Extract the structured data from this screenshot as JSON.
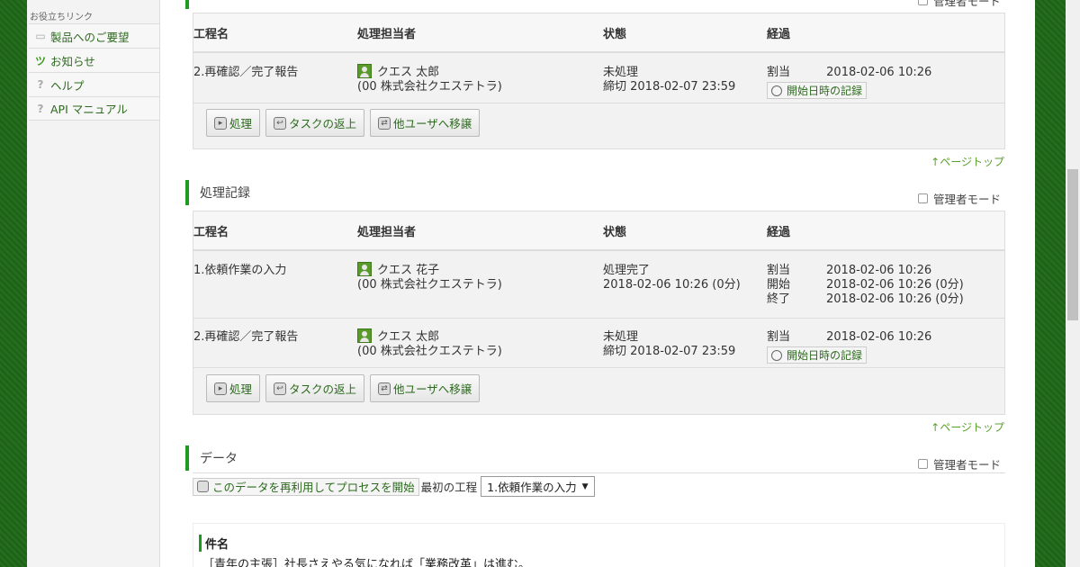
{
  "sidebar": {
    "heading": "お役立ちリンク",
    "items": [
      {
        "label": "製品へのご要望",
        "icon": "speech-icon"
      },
      {
        "label": "お知らせ",
        "icon": "notice-icon"
      },
      {
        "label": "ヘルプ",
        "icon": "question-icon"
      },
      {
        "label": "API マニュアル",
        "icon": "question-icon"
      }
    ]
  },
  "top_admin_label": "管理者モード",
  "columns": {
    "step": "工程名",
    "assignee": "処理担当者",
    "state": "状態",
    "progress": "経過"
  },
  "current_task": {
    "step": "2.再確認／完了報告",
    "user": "クエス 太郎",
    "org": "(00 株式会社クエステトラ)",
    "state": "未処理",
    "deadline": "締切 2018-02-07 23:59",
    "assigned_label": "割当",
    "assigned_time": "2018-02-06 10:26",
    "record_button": "開始日時の記録"
  },
  "actions": {
    "process": "処理",
    "return": "タスクの返上",
    "transfer": "他ユーザへ移譲"
  },
  "pagetop": "↑ページトップ",
  "history": {
    "title": "処理記録",
    "admin_label": "管理者モード",
    "row1": {
      "step": "1.依頼作業の入力",
      "user": "クエス 花子",
      "org": "(00 株式会社クエステトラ)",
      "state": "処理完了",
      "state_time": "2018-02-06 10:26 (0分)",
      "l1": "割当",
      "v1": "2018-02-06 10:26",
      "l2": "開始",
      "v2": "2018-02-06 10:26 (0分)",
      "l3": "終了",
      "v3": "2018-02-06 10:26 (0分)"
    },
    "row2": {
      "step": "2.再確認／完了報告",
      "user": "クエス 太郎",
      "org": "(00 株式会社クエステトラ)",
      "state": "未処理",
      "deadline": "締切 2018-02-07 23:59",
      "l1": "割当",
      "v1": "2018-02-06 10:26",
      "record_button": "開始日時の記録"
    }
  },
  "data_section": {
    "title": "データ",
    "admin_label": "管理者モード",
    "reuse_button": "このデータを再利用してプロセスを開始",
    "first_step_label": "最初の工程",
    "first_step_value": "1.依頼作業の入力",
    "field_label": "件名",
    "field_value": "［青年の主張］社長さえやる気になれば「業務改革」は進む。"
  }
}
